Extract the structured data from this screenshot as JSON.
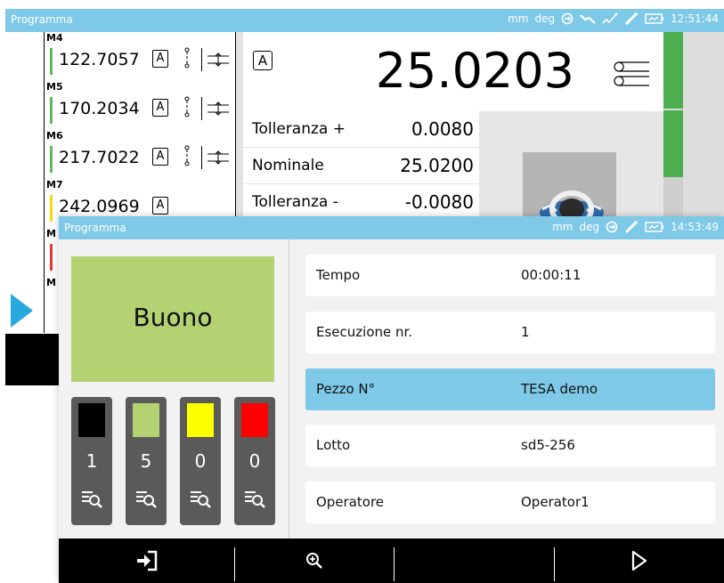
{
  "back_window": {
    "title": "Programma",
    "status": {
      "units": "mm",
      "angle": "deg",
      "time": "12:51:44"
    },
    "measures": [
      {
        "label": "M4",
        "value": "122.7057",
        "mode": "A",
        "bar_color": "#5cb85c"
      },
      {
        "label": "M5",
        "value": "170.2034",
        "mode": "A",
        "bar_color": "#5cb85c"
      },
      {
        "label": "M6",
        "value": "217.7022",
        "mode": "A",
        "bar_color": "#5cb85c"
      },
      {
        "label": "M7",
        "value": "242.0969",
        "mode": "A",
        "bar_color": "#f5d90a"
      },
      {
        "label": "M",
        "value": "",
        "mode": "",
        "bar_color": "#e53935"
      },
      {
        "label": "M",
        "value": "",
        "mode": "",
        "bar_color": ""
      }
    ],
    "current": {
      "mode": "A",
      "value": "25.0203",
      "tol_plus_label": "Tolleranza +",
      "tol_plus": "0.0080",
      "nominal_label": "Nominale",
      "nominal": "25.0200",
      "tol_minus_label": "Tolleranza -",
      "tol_minus": "-0.0080"
    }
  },
  "front_window": {
    "title": "Programma",
    "status": {
      "units": "mm",
      "angle": "deg",
      "time": "14:53:49"
    },
    "result": "Buono",
    "counters": [
      {
        "color": "#000000",
        "count": "1"
      },
      {
        "color": "#b3d272",
        "count": "5"
      },
      {
        "color": "#ffff00",
        "count": "0"
      },
      {
        "color": "#ff0000",
        "count": "0"
      }
    ],
    "fields": [
      {
        "key": "Tempo",
        "value": "00:00:11",
        "selected": false
      },
      {
        "key": "Esecuzione nr.",
        "value": "1",
        "selected": false
      },
      {
        "key": "Pezzo N°",
        "value": "TESA demo",
        "selected": true
      },
      {
        "key": "Lotto",
        "value": "sd5-256",
        "selected": false
      },
      {
        "key": "Operatore",
        "value": "Operator1",
        "selected": false
      }
    ],
    "toolbar": {
      "icons": [
        "login-icon",
        "zoom-in-icon",
        "",
        "play-icon"
      ]
    }
  },
  "colors": {
    "titlebar": "#7fc9e8",
    "accent_blue": "#29a8e0",
    "good_green": "#b3d272",
    "ok_green": "#4dae4f"
  }
}
